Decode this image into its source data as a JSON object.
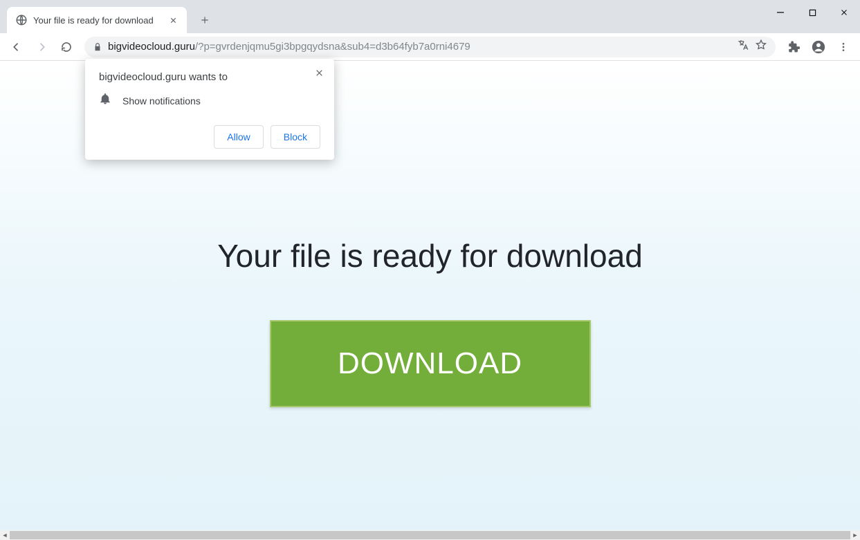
{
  "tab": {
    "title": "Your file is ready for download"
  },
  "url": {
    "host": "bigvideocloud.guru",
    "path": "/?p=gvrdenjqmu5gi3bpgqydsna&sub4=d3b64fyb7a0rni4679"
  },
  "permission": {
    "origin_wants": "bigvideocloud.guru wants to",
    "capability": "Show notifications",
    "allow": "Allow",
    "block": "Block"
  },
  "page": {
    "heading": "Your file is ready for download",
    "download_button": "DOWNLOAD"
  }
}
